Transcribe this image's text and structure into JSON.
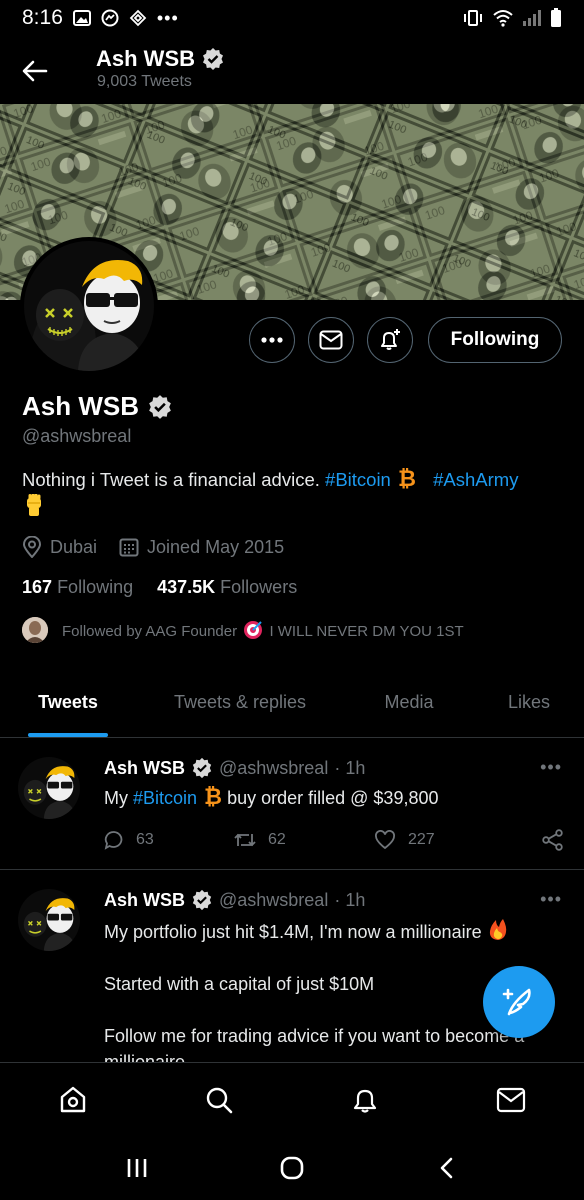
{
  "status_bar": {
    "time": "8:16"
  },
  "header": {
    "title": "Ash WSB",
    "subtitle": "9,003 Tweets"
  },
  "profile": {
    "name": "Ash WSB",
    "handle": "@ashwsbreal",
    "bio_text": "Nothing i Tweet is a financial advice. ",
    "bio_hashtag1": "#Bitcoin",
    "bio_hashtag2": "#AshArmy",
    "location": "Dubai",
    "joined": "Joined May 2015",
    "following_count": "167",
    "following_label": "Following",
    "followers_count": "437.5K",
    "followers_label": "Followers",
    "followed_by": "Followed by AAG Founder",
    "followed_by_tail": "I WILL NEVER DM YOU 1ST",
    "follow_button": "Following"
  },
  "tabs": [
    {
      "label": "Tweets"
    },
    {
      "label": "Tweets & replies"
    },
    {
      "label": "Media"
    },
    {
      "label": "Likes"
    }
  ],
  "tweets": [
    {
      "name": "Ash WSB",
      "handle": "@ashwsbreal",
      "time": "· 1h",
      "text_pre": "My ",
      "hashtag": "#Bitcoin",
      "text_post": " buy order filled @ $39,800",
      "replies": "63",
      "retweets": "62",
      "likes": "227"
    },
    {
      "name": "Ash WSB",
      "handle": "@ashwsbreal",
      "time": "· 1h",
      "line1": "My portfolio just hit $1.4M, I'm now a millionaire",
      "line2": "Started with a capital of just $10M",
      "line3": "Follow me for trading advice if you want to become a millionaire"
    }
  ],
  "colors": {
    "accent": "#1d9bf0",
    "bitcoin": "#f7931a",
    "muted": "#71767b"
  }
}
